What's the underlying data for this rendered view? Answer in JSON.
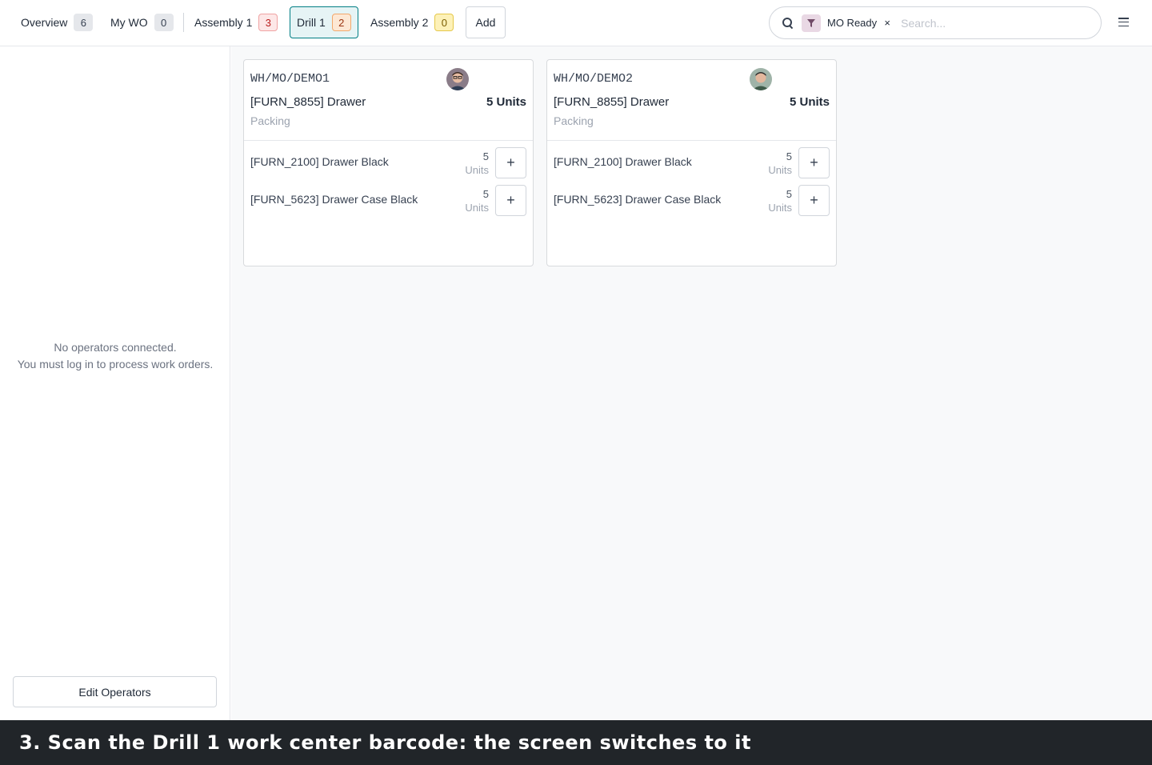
{
  "tabs": [
    {
      "label": "Overview",
      "count": "6"
    },
    {
      "label": "My WO",
      "count": "0"
    },
    {
      "label": "Assembly 1",
      "count": "3"
    },
    {
      "label": "Drill 1",
      "count": "2"
    },
    {
      "label": "Assembly 2",
      "count": "0"
    }
  ],
  "add_label": "Add",
  "search": {
    "facet_label": "MO Ready",
    "facet_close": "×",
    "placeholder": "Search..."
  },
  "sidebar": {
    "no_operators_line1": "No operators connected.",
    "no_operators_line2": "You must log in to process work orders.",
    "edit_operators_label": "Edit Operators"
  },
  "cards": [
    {
      "ref": "WH/MO/DEMO1",
      "product": "[FURN_8855] Drawer",
      "qty": "5 Units",
      "step": "Packing",
      "components": [
        {
          "name": "[FURN_2100] Drawer Black",
          "qty": "5",
          "uom": "Units"
        },
        {
          "name": "[FURN_5623] Drawer Case Black",
          "qty": "5",
          "uom": "Units"
        }
      ]
    },
    {
      "ref": "WH/MO/DEMO2",
      "product": "[FURN_8855] Drawer",
      "qty": "5 Units",
      "step": "Packing",
      "components": [
        {
          "name": "[FURN_2100] Drawer Black",
          "qty": "5",
          "uom": "Units"
        },
        {
          "name": "[FURN_5623] Drawer Case Black",
          "qty": "5",
          "uom": "Units"
        }
      ]
    }
  ],
  "plus_label": "+",
  "caption": "3. Scan the Drill 1 work center barcode: the screen switches to it",
  "colors": {
    "accent": "#017e84",
    "active_tab_bg": "#e6f4f5",
    "caption_bg": "#212529"
  },
  "icons": [
    "search-icon",
    "filter-icon",
    "close-icon",
    "hamburger-menu-icon",
    "avatar",
    "plus-icon"
  ]
}
